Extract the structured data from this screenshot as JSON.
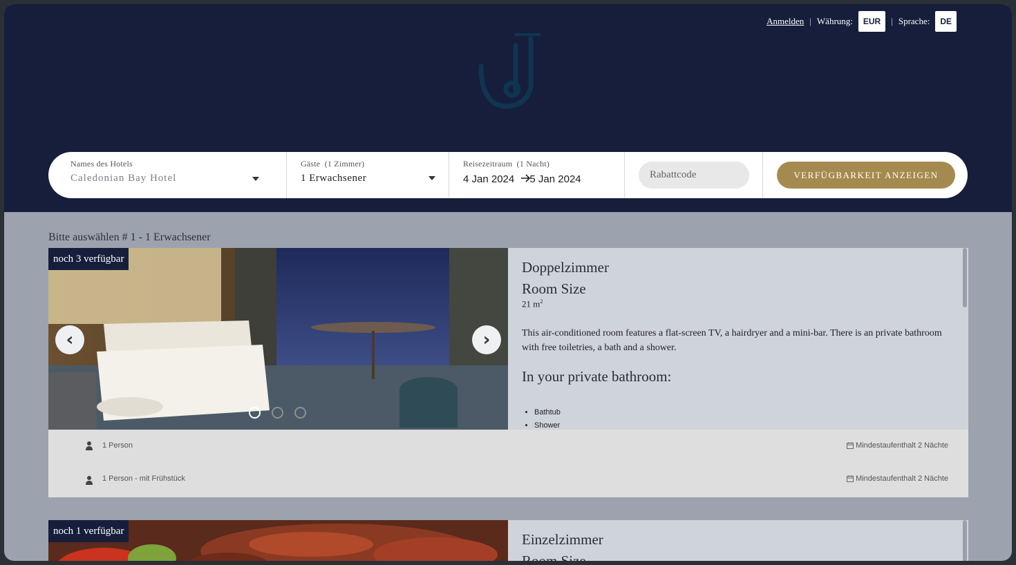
{
  "topbar": {
    "login_link": "Anmelden",
    "currency_label": "Währung:",
    "currency_value": "EUR",
    "language_label": "Sprache:",
    "language_value": "DE",
    "separator": "|"
  },
  "search": {
    "hotel": {
      "label": "Names des Hotels",
      "value": "Caledonian Bay Hotel"
    },
    "guests": {
      "label": "Gäste",
      "label_note": "(1 Zimmer)",
      "value": "1 Erwachsener"
    },
    "dates": {
      "label": "Reisezeitraum",
      "label_note": "(1 Nacht)",
      "start": "4 Jan 2024",
      "end": "5 Jan 2024"
    },
    "promo_placeholder": "Rabattcode",
    "availability_button": "VERFÜGBARKEIT ANZEIGEN"
  },
  "main": {
    "section_title": "Bitte auswählen # 1 - 1 Erwachsener",
    "rooms": [
      {
        "availability": "noch 3 verfügbar",
        "name": "Doppelzimmer",
        "size_title": "Room Size",
        "size_value": "21 m",
        "size_unit_sup": "2",
        "description": "This air-conditioned room features a flat-screen TV, a hairdryer and a mini-bar. There is an private bathroom with free toiletries, a bath and a shower.",
        "bathroom_title": "In your private bathroom:",
        "bathroom_items": [
          "Bathtub",
          "Shower"
        ],
        "rates": [
          {
            "label": "1 Person",
            "min_stay": "Mindestaufenthalt 2 Nächte"
          },
          {
            "label": "1 Person - mit Frühstück",
            "min_stay": "Mindestaufenthalt 2 Nächte"
          }
        ],
        "slides": 3
      },
      {
        "availability": "noch 1 verfügbar",
        "name": "Einzelzimmer",
        "size_title": "Room Size"
      }
    ]
  },
  "colors": {
    "header_bg": "#161e3b",
    "accent_gold": "#a58a4f",
    "page_bg": "#9ca3af"
  }
}
